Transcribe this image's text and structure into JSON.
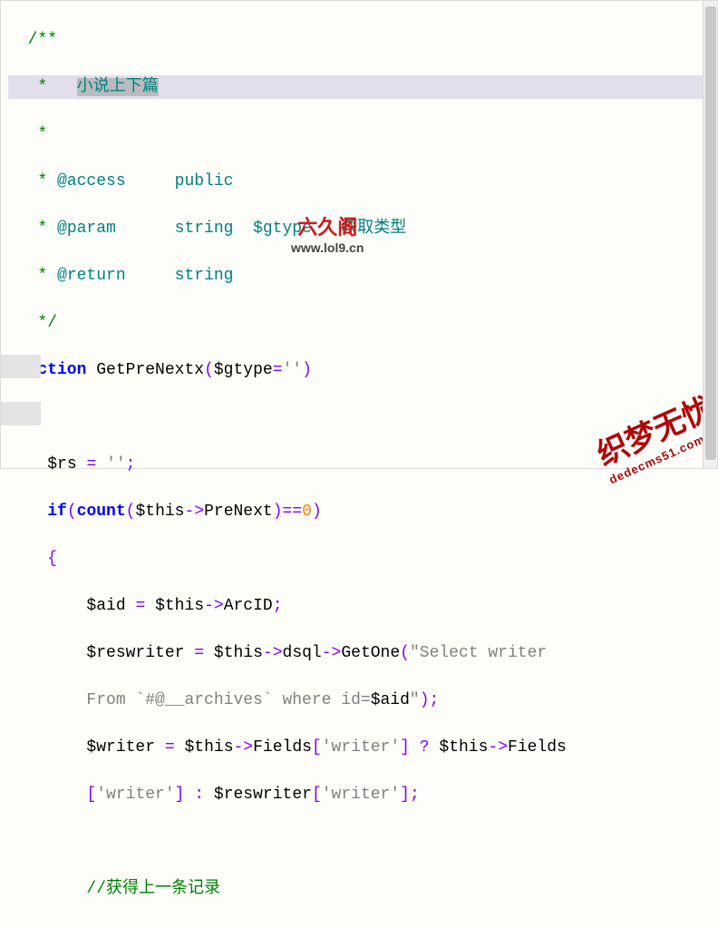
{
  "comment": {
    "open": "/**",
    "title": "小说上下篇",
    "access_tag": "@access",
    "access_val": "public",
    "param_tag": "@param",
    "param_type": "string",
    "param_var": "$gtype",
    "param_desc": "获取类型",
    "return_tag": "@return",
    "return_type": "string",
    "close": "*/"
  },
  "code": {
    "kw_function": "function",
    "fn_name": "GetPreNextx",
    "param_var": "$gtype",
    "param_def": "''",
    "rs_var": "$rs",
    "rs_val": "''",
    "kw_if": "if",
    "fn_count": "count",
    "this": "$this",
    "prop_PreNext": "PreNext",
    "zero": "0",
    "aid_var": "$aid",
    "prop_ArcID": "ArcID",
    "reswriter_var": "$reswriter",
    "prop_dsql": "dsql",
    "fn_GetOne": "GetOne",
    "sql_part1": "\"Select writer",
    "sql_part2": "From `#@__archives` where id=",
    "sql_close": "\"",
    "writer_var": "$writer",
    "prop_Fields": "Fields",
    "key_writer": "'writer'",
    "comment_prev": "//获得上一条记录"
  },
  "watermark": {
    "top": "六久阁",
    "bottom": "www.lol9.cn"
  },
  "stamp": {
    "main": "织梦无忧",
    "sub": "dedecms51.com"
  }
}
